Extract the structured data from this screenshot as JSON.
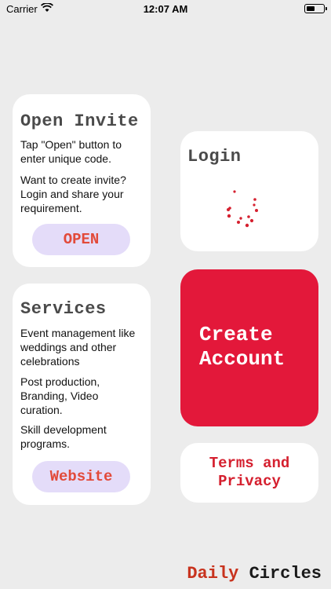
{
  "status_bar": {
    "carrier": "Carrier",
    "time": "12:07 AM"
  },
  "invite": {
    "title": "Open Invite",
    "text1": "Tap \"Open\" button to enter unique code.",
    "text2": "Want to create invite? Login and share your requirement.",
    "button": "OPEN"
  },
  "services": {
    "title": "Services",
    "text1": "Event management like weddings and other celebrations",
    "text2": "Post production, Branding, Video curation.",
    "text3": "Skill development programs.",
    "button": "Website"
  },
  "login": {
    "title": "Login",
    "loading_icon": "spinner-icon"
  },
  "create_account": {
    "label_line1": "Create",
    "label_line2": "Account"
  },
  "terms": {
    "line1": "Terms and",
    "line2": "Privacy"
  },
  "footer": {
    "word1": "Daily",
    "word2": "Circles"
  },
  "colors": {
    "background": "#ececec",
    "accent_red": "#e3183a",
    "pill_bg": "#e4dcf9",
    "pill_text": "#e24a3a"
  }
}
